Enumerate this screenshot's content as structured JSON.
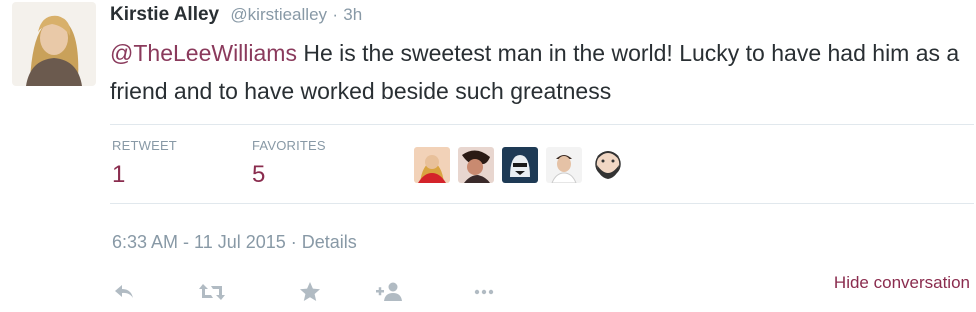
{
  "tweet": {
    "author_name": "Kirstie Alley",
    "author_handle": "@kirstiealley",
    "separator": "·",
    "time_ago": "3h",
    "mention": "@TheLeeWilliams",
    "text": " He is the sweetest man in the world! Lucky to have had him as a friend and to have worked beside such greatness"
  },
  "stats": {
    "retweet_label": "RETWEET",
    "retweet_count": "1",
    "favorites_label": "FAVORITES",
    "favorites_count": "5"
  },
  "meta": {
    "timestamp": "6:33 AM - 11 Jul 2015",
    "separator": " · ",
    "details_label": "Details"
  },
  "conversation": {
    "hide_label": "Hide conversation"
  },
  "icons": [
    "reply-icon",
    "retweet-icon",
    "favorite-star-icon",
    "follow-icon",
    "more-icon"
  ],
  "colors": {
    "accent": "#8a2c4e",
    "muted": "#8899a6",
    "text": "#292f33",
    "divider": "#e1e8ed"
  }
}
